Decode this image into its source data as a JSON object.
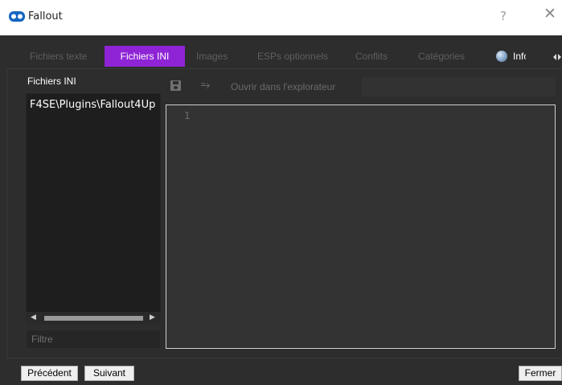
{
  "window": {
    "title": "Fallout",
    "help_label": "?",
    "close_label": "✕"
  },
  "tabs": [
    {
      "label": "Fichiers texte",
      "active": false
    },
    {
      "label": "Fichiers INI",
      "active": true
    },
    {
      "label": "Images",
      "active": false
    },
    {
      "label": "ESPs optionnels",
      "active": false
    },
    {
      "label": "Conflits",
      "active": false
    },
    {
      "label": "Catégories",
      "active": false
    },
    {
      "label": "Infos du",
      "active": false
    }
  ],
  "left_panel": {
    "title": "Fichiers INI",
    "files": [
      "F4SE\\Plugins\\Fallout4Up"
    ],
    "filter_placeholder": "Filtre"
  },
  "toolbar": {
    "open_label": "Ouvrir dans l'explorateur",
    "path_value": ""
  },
  "editor": {
    "line_numbers": [
      "1"
    ]
  },
  "footer": {
    "previous_label": "Précédent",
    "next_label": "Suivant",
    "close_label": "Fermer"
  },
  "colors": {
    "accent": "#8e24d6",
    "background": "#2d2d2d",
    "list_background": "#1e1e1e",
    "editor_background": "#333333"
  }
}
